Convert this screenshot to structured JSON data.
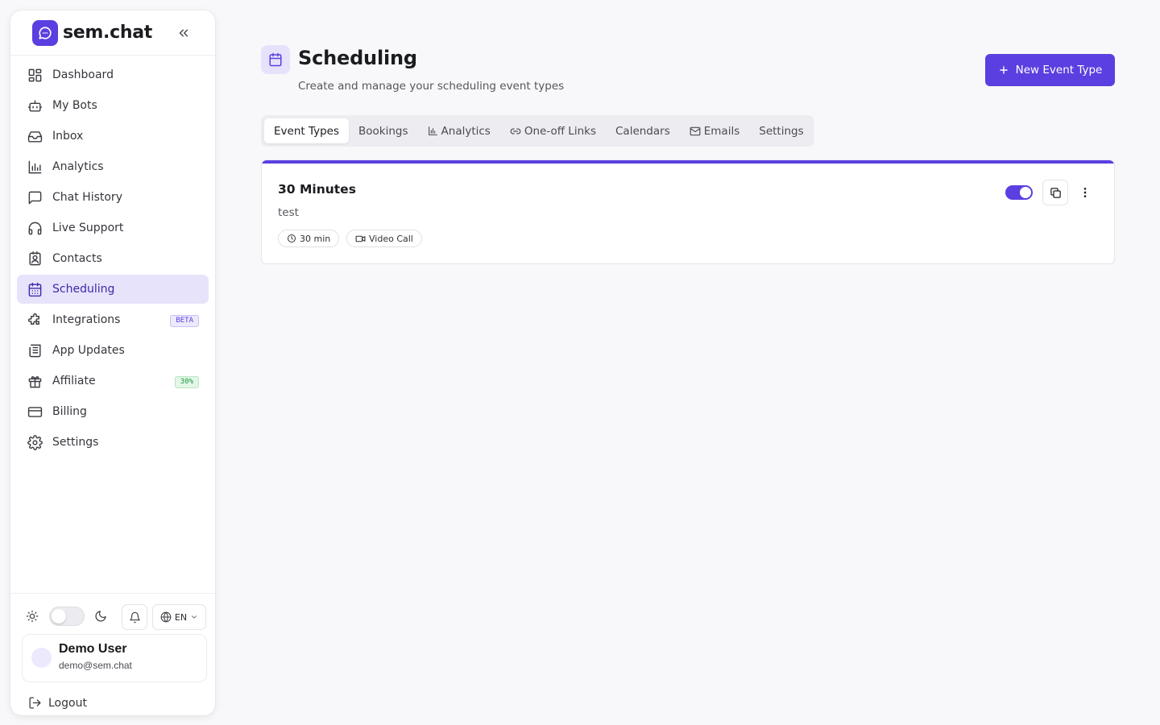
{
  "brand": {
    "name": "sem.chat"
  },
  "sidebar": {
    "items": [
      {
        "label": "Dashboard",
        "icon": "dashboard-icon"
      },
      {
        "label": "My Bots",
        "icon": "bot-icon"
      },
      {
        "label": "Inbox",
        "icon": "inbox-icon"
      },
      {
        "label": "Analytics",
        "icon": "chart-icon"
      },
      {
        "label": "Chat History",
        "icon": "message-icon"
      },
      {
        "label": "Live Support",
        "icon": "headphones-icon"
      },
      {
        "label": "Contacts",
        "icon": "contact-icon"
      },
      {
        "label": "Scheduling",
        "icon": "calendar-icon",
        "active": true
      },
      {
        "label": "Integrations",
        "icon": "puzzle-icon",
        "badge": "BETA"
      },
      {
        "label": "App Updates",
        "icon": "newspaper-icon"
      },
      {
        "label": "Affiliate",
        "icon": "gift-icon",
        "badge": "30%"
      },
      {
        "label": "Billing",
        "icon": "credit-card-icon"
      },
      {
        "label": "Settings",
        "icon": "gear-icon"
      }
    ],
    "footer": {
      "language": "EN",
      "user": {
        "name": "Demo User",
        "email": "demo@sem.chat"
      },
      "logout_label": "Logout"
    }
  },
  "header": {
    "title": "Scheduling",
    "subtitle": "Create and manage your scheduling event types",
    "new_button_label": "New Event Type"
  },
  "tabs": [
    {
      "label": "Event Types",
      "active": true
    },
    {
      "label": "Bookings"
    },
    {
      "label": "Analytics",
      "icon": "bar-chart-icon"
    },
    {
      "label": "One-off Links",
      "icon": "link-icon"
    },
    {
      "label": "Calendars"
    },
    {
      "label": "Emails",
      "icon": "mail-icon"
    },
    {
      "label": "Settings"
    }
  ],
  "event_types": [
    {
      "title": "30 Minutes",
      "description": "test",
      "duration": "30 min",
      "location": "Video Call",
      "enabled": true
    }
  ],
  "colors": {
    "accent": "#5b3fe0",
    "active_bg": "#e7e3fb"
  }
}
